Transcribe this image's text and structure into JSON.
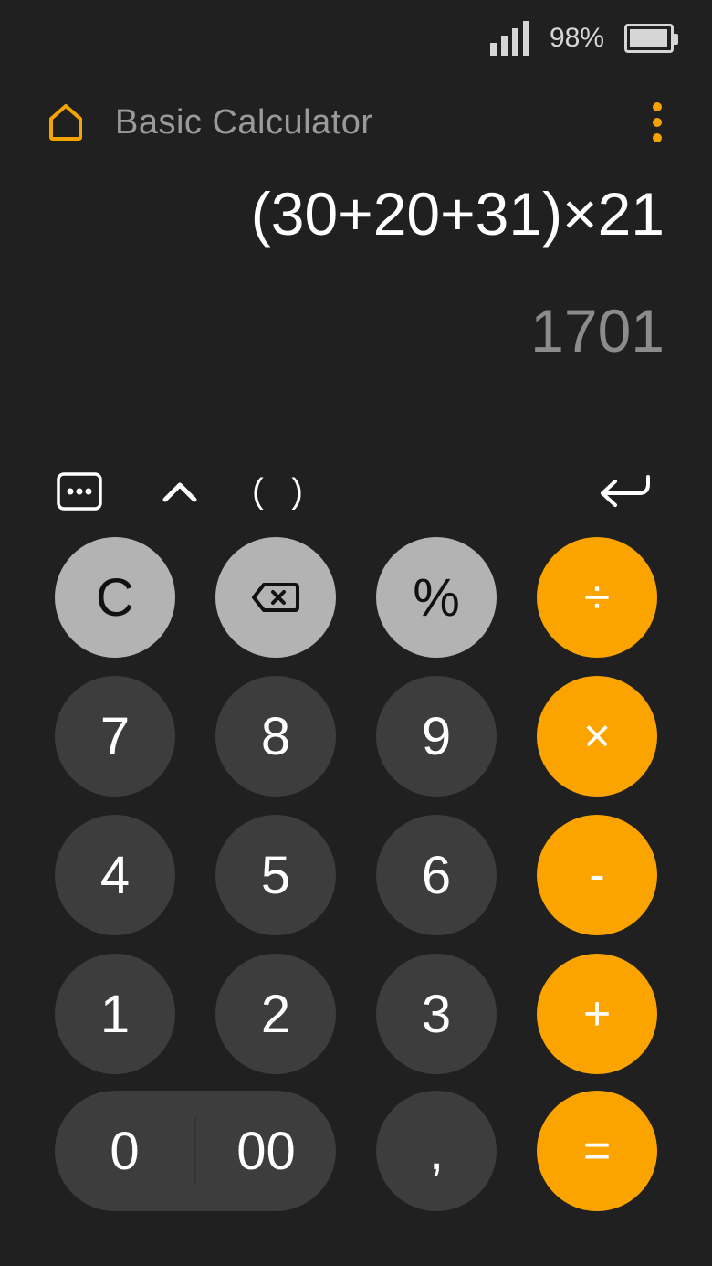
{
  "status": {
    "battery_percent_label": "98%",
    "battery_level": 0.98,
    "signal_bars": 4
  },
  "header": {
    "title": "Basic Calculator",
    "home_icon": "home-icon",
    "menu_icon": "more-vertical-icon"
  },
  "display": {
    "expression": "(30+20+31)×21",
    "result": "1701"
  },
  "toolbar": {
    "more_icon": "more-options-icon",
    "caret_icon": "caret-up-icon",
    "paren_label": "( )",
    "return_icon": "return-icon"
  },
  "keys": {
    "clear": "C",
    "backspace_icon": "backspace-icon",
    "percent": "%",
    "divide": "÷",
    "seven": "7",
    "eight": "8",
    "nine": "9",
    "multiply": "×",
    "four": "4",
    "five": "5",
    "six": "6",
    "minus": "-",
    "one": "1",
    "two": "2",
    "three": "3",
    "plus": "+",
    "zero": "0",
    "double_zero": "00",
    "comma": ",",
    "equals": "="
  },
  "colors": {
    "accent": "#fba400",
    "background": "#202020",
    "key_dark": "#3d3d3d",
    "key_light": "#b3b3b3"
  }
}
